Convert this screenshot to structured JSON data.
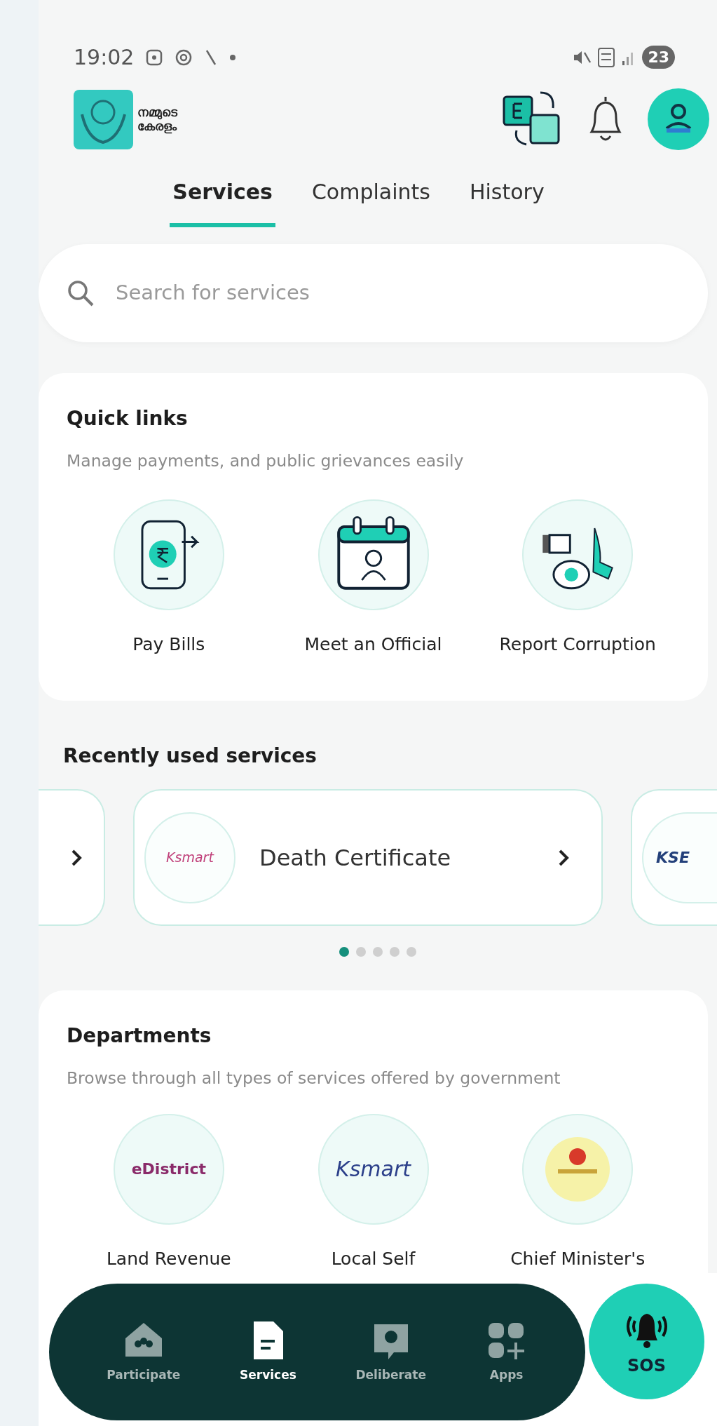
{
  "status_bar": {
    "time": "19:02",
    "battery": "23"
  },
  "header": {
    "logo_lines": [
      "നമ്മുടെ",
      "കേരളം"
    ]
  },
  "tabs": [
    {
      "label": "Services",
      "selected": true
    },
    {
      "label": "Complaints",
      "selected": false
    },
    {
      "label": "History",
      "selected": false
    }
  ],
  "search": {
    "placeholder": "Search for services"
  },
  "quick_links": {
    "title": "Quick links",
    "subtitle": "Manage payments, and public grievances easily",
    "items": [
      {
        "label": "Pay Bills",
        "kind": "payment"
      },
      {
        "label": "Meet an Official",
        "kind": "calendar"
      },
      {
        "label": "Report Corruption",
        "kind": "bribe"
      }
    ]
  },
  "recent": {
    "title": "Recently used services",
    "cards": [
      {
        "kind": "partial-left"
      },
      {
        "kind": "full",
        "logo_text": "Ksmart",
        "label": "Death Certificate"
      },
      {
        "kind": "partial-right",
        "logo_text": "KSE"
      }
    ],
    "dots": [
      {
        "selected": true
      },
      {
        "selected": false
      },
      {
        "selected": false
      },
      {
        "selected": false
      },
      {
        "selected": false
      }
    ]
  },
  "departments": {
    "title": "Departments",
    "subtitle": "Browse through all types of services offered by government",
    "items": [
      {
        "label": "Land Revenue",
        "kind": "edistrict",
        "logo_text": "eDistrict"
      },
      {
        "label": "Local Self",
        "kind": "ksmart",
        "logo_text": "Ksmart"
      },
      {
        "label": "Chief Minister's",
        "kind": "emblem"
      }
    ]
  },
  "bottom_nav": {
    "items": [
      {
        "label": "Participate",
        "kind": "house",
        "selected": false
      },
      {
        "label": "Services",
        "kind": "document",
        "selected": true
      },
      {
        "label": "Deliberate",
        "kind": "bulb",
        "selected": false
      },
      {
        "label": "Apps",
        "kind": "apps",
        "selected": false
      }
    ],
    "sos": {
      "label": "SOS"
    }
  }
}
